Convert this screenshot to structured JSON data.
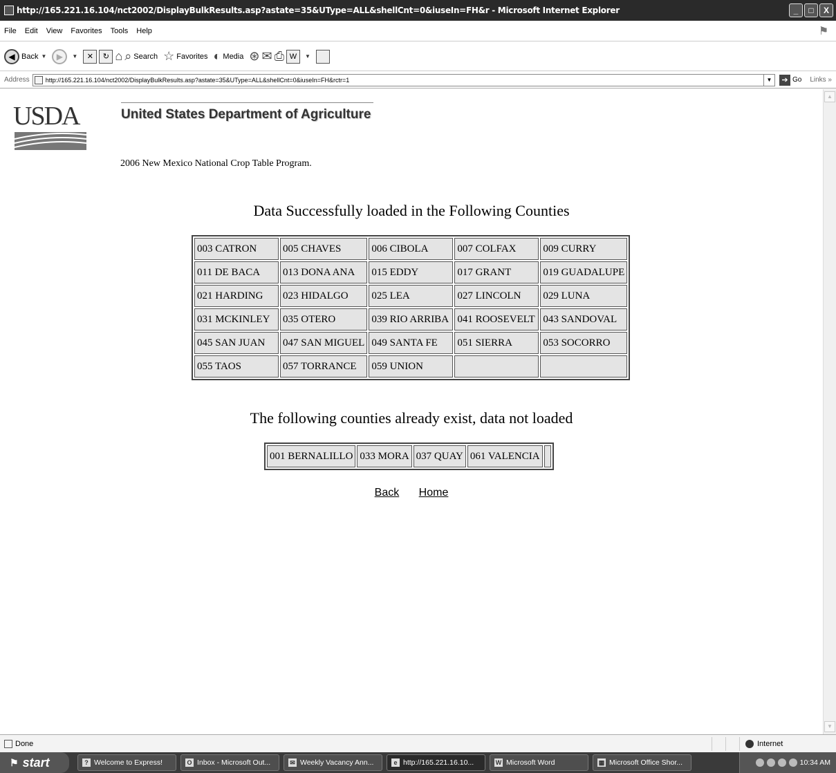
{
  "window": {
    "title": "http://165.221.16.104/nct2002/DisplayBulkResults.asp?astate=35&UType=ALL&shellCnt=0&iuseIn=FH&r - Microsoft Internet Explorer",
    "controls": {
      "minimize": "_",
      "maximize": "□",
      "close": "X"
    }
  },
  "menu": [
    "File",
    "Edit",
    "View",
    "Favorites",
    "Tools",
    "Help"
  ],
  "toolbar": {
    "back_label": "Back",
    "search_label": "Search",
    "favorites_label": "Favorites",
    "media_label": "Media"
  },
  "address": {
    "label": "Address",
    "url": "http://165.221.16.104/nct2002/DisplayBulkResults.asp?astate=35&UType=ALL&shellCnt=0&iuseIn=FH&rctr=1",
    "go_label": "Go",
    "links_label": "Links »"
  },
  "page": {
    "logo_text": "USDA",
    "agency_title": "United States Department of Agriculture",
    "program_line": "2006 New Mexico National Crop Table Program.",
    "loaded_heading": "Data Successfully loaded in the Following Counties",
    "loaded_rows": [
      [
        "003 CATRON",
        "005 CHAVES",
        "006 CIBOLA",
        "007 COLFAX",
        "009 CURRY"
      ],
      [
        "011 DE BACA",
        "013 DONA ANA",
        "015 EDDY",
        "017 GRANT",
        "019 GUADALUPE"
      ],
      [
        "021 HARDING",
        "023 HIDALGO",
        "025 LEA",
        "027 LINCOLN",
        "029 LUNA"
      ],
      [
        "031 MCKINLEY",
        "035 OTERO",
        "039 RIO ARRIBA",
        "041 ROOSEVELT",
        "043 SANDOVAL"
      ],
      [
        "045 SAN JUAN",
        "047 SAN MIGUEL",
        "049 SANTA FE",
        "051 SIERRA",
        "053 SOCORRO"
      ],
      [
        "055 TAOS",
        "057 TORRANCE",
        "059 UNION",
        "",
        ""
      ]
    ],
    "existing_heading": "The following counties already exist, data not loaded",
    "existing_row": [
      "001 BERNALILLO",
      "033 MORA",
      "037 QUAY",
      "061 VALENCIA",
      ""
    ],
    "links": {
      "back": "Back",
      "home": "Home"
    }
  },
  "status": {
    "left": "Done",
    "zone": "Internet"
  },
  "taskbar": {
    "start_label": "start",
    "tasks": [
      {
        "label": "Welcome to Express!",
        "icon": "?",
        "active": false
      },
      {
        "label": "Inbox - Microsoft Out...",
        "icon": "O",
        "active": false
      },
      {
        "label": "Weekly Vacancy Ann...",
        "icon": "✉",
        "active": false
      },
      {
        "label": "http://165.221.16.10...",
        "icon": "e",
        "active": true
      },
      {
        "label": "Microsoft Word",
        "icon": "W",
        "active": false
      },
      {
        "label": "Microsoft Office Shor...",
        "icon": "▦",
        "active": false
      }
    ],
    "clock": "10:34 AM"
  }
}
